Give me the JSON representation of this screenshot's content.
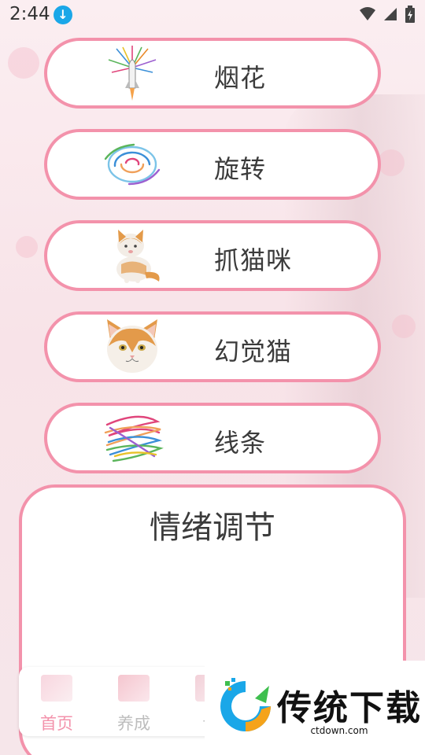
{
  "status_bar": {
    "time": "2:44",
    "icons": [
      "download-icon",
      "wifi-icon",
      "signal-icon",
      "battery-icon"
    ]
  },
  "features": [
    {
      "label": "烟花",
      "icon": "rocket-fireworks-icon"
    },
    {
      "label": "旋转",
      "icon": "swirl-icon"
    },
    {
      "label": "抓猫咪",
      "icon": "sitting-cat-icon"
    },
    {
      "label": "幻觉猫",
      "icon": "cat-face-icon"
    },
    {
      "label": "线条",
      "icon": "scribble-lines-icon"
    }
  ],
  "emotion_panel": {
    "title": "情绪调节"
  },
  "bottom_nav": {
    "items": [
      {
        "label": "首页",
        "active": true
      },
      {
        "label": "养成",
        "active": false
      },
      {
        "label": "设",
        "active": false
      }
    ]
  },
  "watermark": {
    "brand": "传统下载",
    "domain": "ctdown.com"
  },
  "colors": {
    "accent_pink": "#f392ab",
    "text": "#3b3b3b",
    "inactive_nav": "#bdbdbd",
    "download_badge": "#1aa7e8"
  }
}
